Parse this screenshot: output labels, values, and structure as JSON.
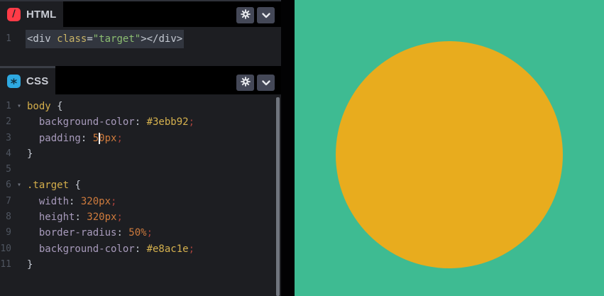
{
  "editor": {
    "fold_icon_glyph": "▾",
    "html_panel": {
      "tab_label": "HTML",
      "tab_icon": "html-icon",
      "tab_icon_glyph": "/",
      "tab_icon_color": "#ff3b47",
      "code_lines": [
        {
          "num": "1",
          "selected": true,
          "tokens": [
            {
              "text": "<div ",
              "type": "tag"
            },
            {
              "text": "class",
              "type": "attr"
            },
            {
              "text": "=",
              "type": "punct"
            },
            {
              "text": "\"target\"",
              "type": "string"
            },
            {
              "text": "></div>",
              "type": "tag"
            }
          ]
        }
      ]
    },
    "css_panel": {
      "tab_label": "CSS",
      "tab_icon": "css-icon",
      "tab_icon_glyph": "*",
      "tab_icon_color": "#2ea9e1",
      "code_lines": [
        {
          "num": "1",
          "fold": true,
          "tokens": [
            {
              "text": "body ",
              "type": "selector"
            },
            {
              "text": "{",
              "type": "punct"
            }
          ]
        },
        {
          "num": "2",
          "tokens": [
            {
              "text": "  ",
              "type": "punct"
            },
            {
              "text": "background-color",
              "type": "property"
            },
            {
              "text": ": ",
              "type": "punct"
            },
            {
              "text": "#3ebb92",
              "type": "hex"
            },
            {
              "text": ";",
              "type": "semi"
            }
          ]
        },
        {
          "num": "3",
          "caret_col": 12,
          "tokens": [
            {
              "text": "  ",
              "type": "punct"
            },
            {
              "text": "padding",
              "type": "property"
            },
            {
              "text": ": ",
              "type": "punct"
            },
            {
              "text": "50px",
              "type": "number"
            },
            {
              "text": ";",
              "type": "semi"
            }
          ]
        },
        {
          "num": "4",
          "tokens": [
            {
              "text": "}",
              "type": "punct"
            }
          ]
        },
        {
          "num": "5",
          "tokens": []
        },
        {
          "num": "6",
          "fold": true,
          "tokens": [
            {
              "text": ".target ",
              "type": "selector"
            },
            {
              "text": "{",
              "type": "punct"
            }
          ]
        },
        {
          "num": "7",
          "tokens": [
            {
              "text": "  ",
              "type": "punct"
            },
            {
              "text": "width",
              "type": "property"
            },
            {
              "text": ": ",
              "type": "punct"
            },
            {
              "text": "320px",
              "type": "number"
            },
            {
              "text": ";",
              "type": "semi"
            }
          ]
        },
        {
          "num": "8",
          "tokens": [
            {
              "text": "  ",
              "type": "punct"
            },
            {
              "text": "height",
              "type": "property"
            },
            {
              "text": ": ",
              "type": "punct"
            },
            {
              "text": "320px",
              "type": "number"
            },
            {
              "text": ";",
              "type": "semi"
            }
          ]
        },
        {
          "num": "9",
          "tokens": [
            {
              "text": "  ",
              "type": "punct"
            },
            {
              "text": "border-radius",
              "type": "property"
            },
            {
              "text": ": ",
              "type": "punct"
            },
            {
              "text": "50%",
              "type": "number"
            },
            {
              "text": ";",
              "type": "semi"
            }
          ]
        },
        {
          "num": "10",
          "tokens": [
            {
              "text": "  ",
              "type": "punct"
            },
            {
              "text": "background-color",
              "type": "property"
            },
            {
              "text": ": ",
              "type": "punct"
            },
            {
              "text": "#e8ac1e",
              "type": "hex"
            },
            {
              "text": ";",
              "type": "semi"
            }
          ]
        },
        {
          "num": "11",
          "tokens": [
            {
              "text": "}",
              "type": "punct"
            }
          ]
        }
      ]
    },
    "icons": {
      "settings_icon": "gear-icon",
      "collapse_icon": "chevron-down-icon",
      "fold_icon": "fold-arrow-icon"
    }
  },
  "syntax_colors": {
    "tag": "#c5cad3",
    "attr": "#c9b467",
    "string": "#8cbe71",
    "punct": "#c5cad3",
    "selector": "#d4ae4b",
    "property": "#a89bbc",
    "number": "#cf7b3d",
    "hex": "#d5b14e",
    "semi": "#a8423c",
    "selection_background": "#32363f",
    "caret_color": "#ffffff"
  },
  "preview": {
    "background_color": "#3ebb92",
    "shape": "circle",
    "shape_color": "#e8ac1e"
  }
}
